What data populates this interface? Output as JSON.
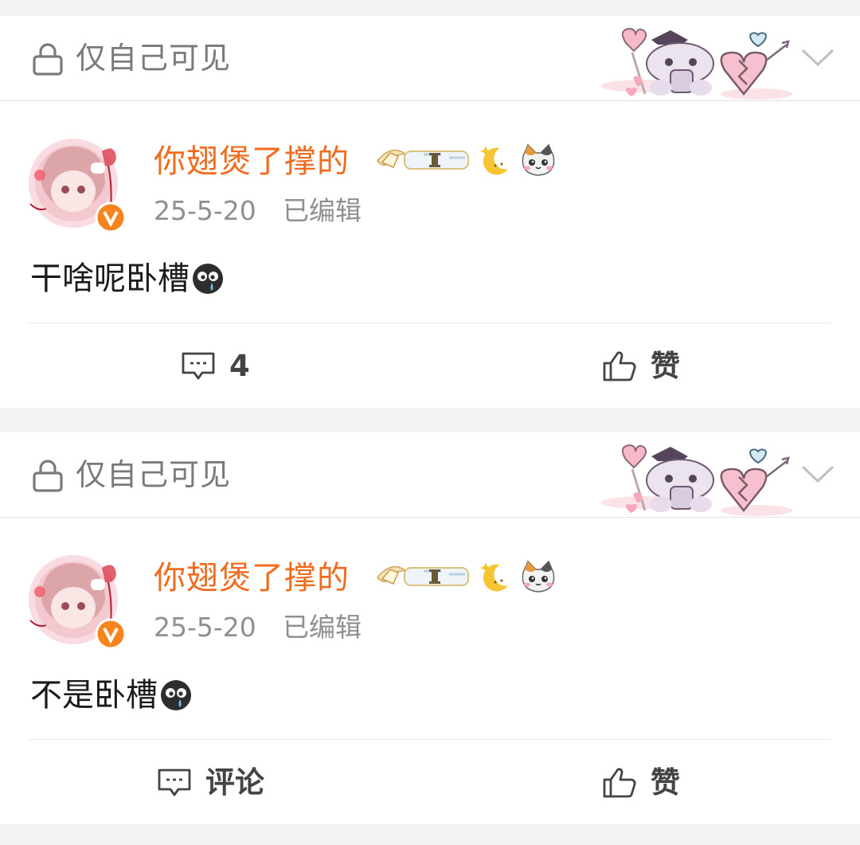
{
  "posts": [
    {
      "visibility": "仅自己可见",
      "author": "你翅煲了撑的",
      "date": "25-5-20",
      "edited": "已编辑",
      "text": "干啥呢卧槽",
      "comment_label": "4",
      "like_label": "赞"
    },
    {
      "visibility": "仅自己可见",
      "author": "你翅煲了撑的",
      "date": "25-5-20",
      "edited": "已编辑",
      "text": "不是卧槽",
      "comment_label": "评论",
      "like_label": "赞"
    }
  ],
  "icons": {
    "lock": "lock-icon",
    "chevron": "chevron-down-icon",
    "verified": "verified-badge-icon",
    "moon": "moon-icon",
    "cat": "cat-face-icon",
    "cry": "crying-emoji-icon",
    "comment": "comment-icon",
    "like": "thumbs-up-icon"
  },
  "colors": {
    "author_name": "#f26b1d",
    "verified_badge": "#f7841e",
    "page_bg": "#f2f2f2",
    "card_bg": "#ffffff"
  }
}
